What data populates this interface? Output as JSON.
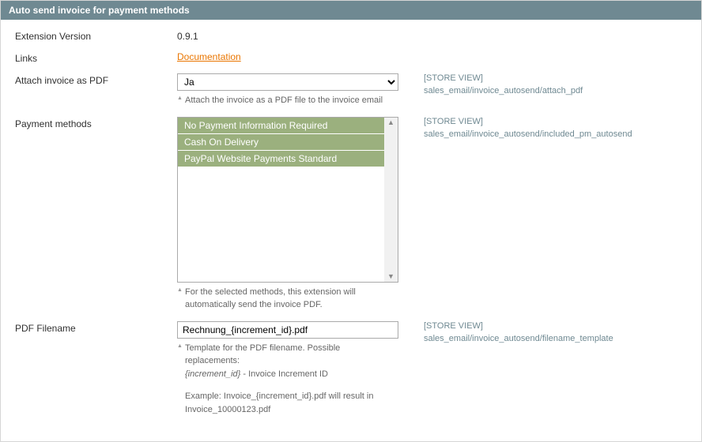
{
  "header": {
    "title": "Auto send invoice for payment methods"
  },
  "rows": {
    "version": {
      "label": "Extension Version",
      "value": "0.9.1"
    },
    "links": {
      "label": "Links",
      "link_text": "Documentation"
    },
    "attach": {
      "label": "Attach invoice as PDF",
      "selected": "Ja",
      "hint": "Attach the invoice as a PDF file to the invoice email",
      "scope": "[STORE VIEW]",
      "path": "sales_email/invoice_autosend/attach_pdf"
    },
    "methods": {
      "label": "Payment methods",
      "options": [
        "No Payment Information Required",
        "Cash On Delivery",
        "PayPal Website Payments Standard"
      ],
      "hint1": "For the selected methods, this extension will",
      "hint2": "automatically send the invoice PDF.",
      "scope": "[STORE VIEW]",
      "path": "sales_email/invoice_autosend/included_pm_autosend"
    },
    "filename": {
      "label": "PDF Filename",
      "value": "Rechnung_{increment_id}.pdf",
      "hint1": "Template for the PDF filename. Possible",
      "hint2": "replacements:",
      "hint3a": "{increment_id}",
      "hint3b": " - Invoice Increment ID",
      "example1": "Example: Invoice_{increment_id}.pdf will result in",
      "example2": "Invoice_10000123.pdf",
      "scope": "[STORE VIEW]",
      "path": "sales_email/invoice_autosend/filename_template"
    }
  }
}
